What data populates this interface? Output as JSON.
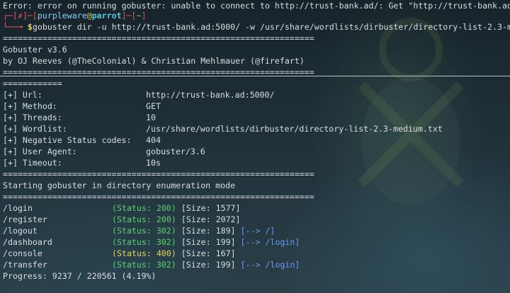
{
  "error_line": "Error: error on running gobuster: unable to connect to http://trust-bank.ad/: Get \"http://trust-bank.ad",
  "prompt": {
    "top_left": "┌─[",
    "x_mark": "✗",
    "mid1": "]─[",
    "user": "purpleware",
    "at": "@",
    "host": "parrot",
    "mid2": "]─[",
    "path": "~",
    "end": "]",
    "bottom": "└──╼ ",
    "dollar": "$",
    "command": "gobuster dir -u http://trust-bank.ad:5000/ -w /usr/share/wordlists/dirbuster/directory-list-2.3-m"
  },
  "separator": "===============================================================",
  "separator_short": "============",
  "banner": {
    "title": "Gobuster v3.6",
    "authors": "by OJ Reeves (@TheColonial) & Christian Mehlmauer (@firefart)"
  },
  "config": [
    {
      "key": "[+] Url:",
      "value": "http://trust-bank.ad:5000/"
    },
    {
      "key": "[+] Method:",
      "value": "GET"
    },
    {
      "key": "[+] Threads:",
      "value": "10"
    },
    {
      "key": "[+] Wordlist:",
      "value": "/usr/share/wordlists/dirbuster/directory-list-2.3-medium.txt"
    },
    {
      "key": "[+] Negative Status codes:",
      "value": "404"
    },
    {
      "key": "[+] User Agent:",
      "value": "gobuster/3.6"
    },
    {
      "key": "[+] Timeout:",
      "value": "10s"
    }
  ],
  "start_message": "Starting gobuster in directory enumeration mode",
  "results": [
    {
      "path": "/login",
      "status_label": "(Status: ",
      "status": "200",
      "status_close": ")",
      "size": "[Size: 1577]",
      "redirect": ""
    },
    {
      "path": "/register",
      "status_label": "(Status: ",
      "status": "200",
      "status_close": ")",
      "size": "[Size: 2072]",
      "redirect": ""
    },
    {
      "path": "/logout",
      "status_label": "(Status: ",
      "status": "302",
      "status_close": ")",
      "size": "[Size: 189]",
      "redirect": "[--> /]"
    },
    {
      "path": "/dashboard",
      "status_label": "(Status: ",
      "status": "302",
      "status_close": ")",
      "size": "[Size: 199]",
      "redirect": "[--> /login]"
    },
    {
      "path": "/console",
      "status_label": "(Status: ",
      "status": "400",
      "status_close": ")",
      "size": "[Size: 167]",
      "redirect": ""
    },
    {
      "path": "/transfer",
      "status_label": "(Status: ",
      "status": "302",
      "status_close": ")",
      "size": "[Size: 199]",
      "redirect": "[--> /login]"
    }
  ],
  "progress": "Progress: 9237 / 220561 (4.19%)",
  "colors": {
    "status_200": "#5fd26e",
    "status_302": "#5fd26e",
    "status_400": "#e4d55a",
    "redirect": "#6a9bf0",
    "prompt_red": "#e0585b",
    "prompt_cyan": "#57c7e0"
  }
}
